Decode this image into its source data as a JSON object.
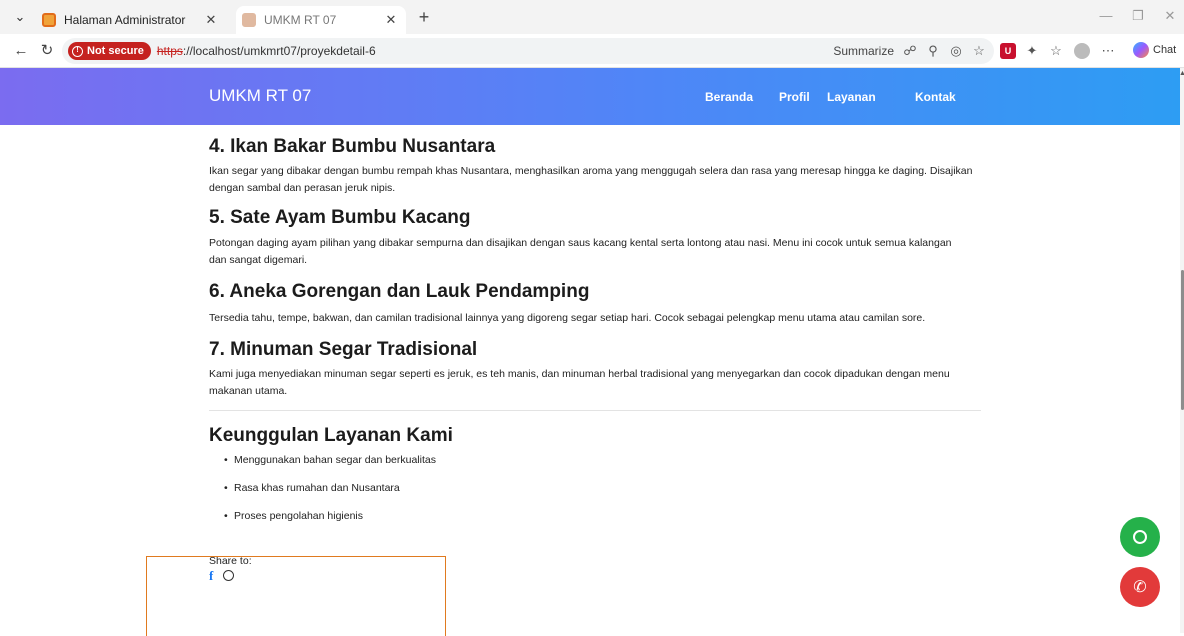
{
  "browser": {
    "tabs": [
      {
        "title": "Halaman Administrator",
        "close": "✕"
      },
      {
        "title": "UMKM RT 07",
        "close": "✕"
      }
    ],
    "new_tab": "+",
    "security_badge": "Not secure",
    "url_scheme": "https",
    "url_rest": "://localhost/umkmrt07/proyekdetail-6",
    "summarize_label": "Summarize",
    "chat_label": "Chat"
  },
  "site": {
    "brand": "UMKM RT 07",
    "nav": [
      "Beranda",
      "Profil",
      "Layanan",
      "Kontak"
    ],
    "colors": {
      "header_start": "#7b6cf0",
      "header_end": "#2d9df3",
      "whatsapp": "#25b14a",
      "call": "#e23a3a"
    }
  },
  "menu_items": [
    {
      "title": "4. Ikan Bakar Bumbu Nusantara",
      "desc_lines": [
        "Ikan segar yang dibakar dengan bumbu rempah khas Nusantara, menghasilkan aroma yang menggugah selera dan rasa yang meresap hingga ke daging. Disajikan",
        "dengan sambal dan perasan jeruk nipis."
      ]
    },
    {
      "title": "5. Sate Ayam Bumbu Kacang",
      "desc_lines": [
        "Potongan daging ayam pilihan yang dibakar sempurna dan disajikan dengan saus kacang kental serta lontong atau nasi. Menu ini cocok untuk semua kalangan",
        "dan sangat digemari."
      ]
    },
    {
      "title": "6. Aneka Gorengan dan Lauk Pendamping",
      "desc_lines": [
        "Tersedia tahu, tempe, bakwan, dan camilan tradisional lainnya yang digoreng segar setiap hari. Cocok sebagai pelengkap menu utama atau camilan sore."
      ]
    },
    {
      "title": "7. Minuman Segar Tradisional",
      "desc_lines": [
        "Kami juga menyediakan minuman segar seperti es jeruk, es teh manis, dan minuman herbal tradisional yang menyegarkan dan cocok dipadukan dengan menu",
        "makanan utama."
      ]
    }
  ],
  "advantages": {
    "title": "Keunggulan Layanan Kami",
    "items": [
      "Menggunakan bahan segar dan berkualitas",
      "Rasa khas rumahan dan Nusantara",
      "Proses pengolahan higienis"
    ]
  },
  "share": {
    "label": "Share to:",
    "facebook_glyph": "f"
  }
}
